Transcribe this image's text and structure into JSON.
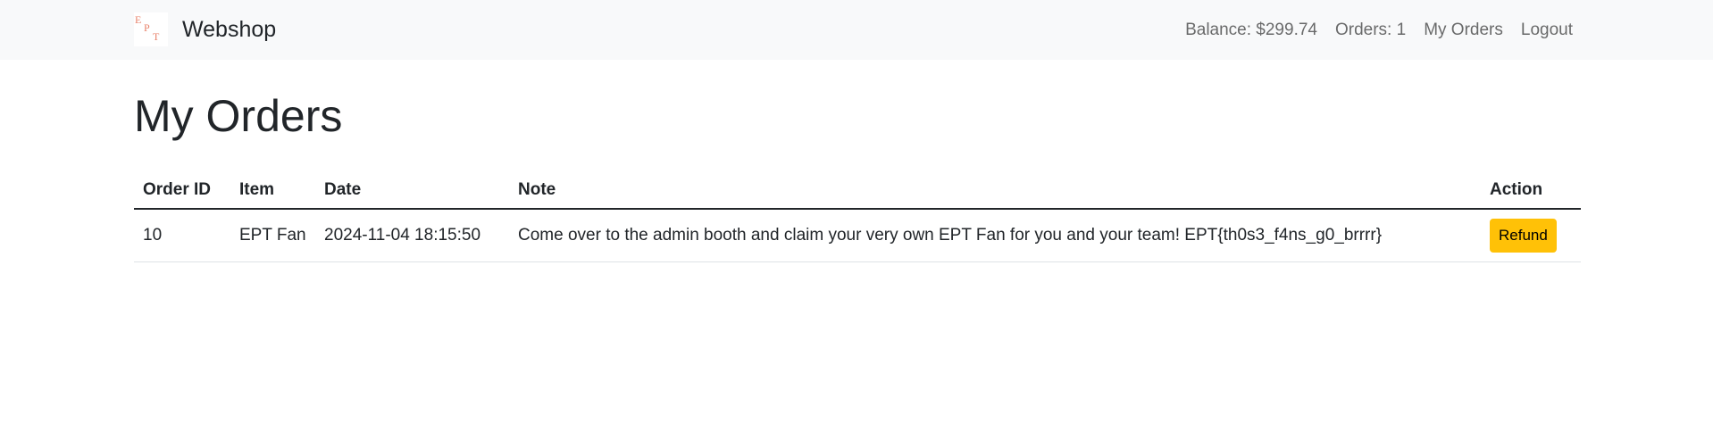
{
  "navbar": {
    "brand": "Webshop",
    "logo_text": "EPT",
    "balance": "Balance: $299.74",
    "orders_count": "Orders: 1",
    "my_orders_link": "My Orders",
    "logout_link": "Logout"
  },
  "page": {
    "title": "My Orders"
  },
  "table": {
    "headers": {
      "order_id": "Order ID",
      "item": "Item",
      "date": "Date",
      "note": "Note",
      "action": "Action"
    },
    "rows": [
      {
        "order_id": "10",
        "item": "EPT Fan",
        "date": "2024-11-04 18:15:50",
        "note": "Come over to the admin booth and claim your very own EPT Fan for you and your team! EPT{th0s3_f4ns_g0_brrrr}",
        "action_label": "Refund"
      }
    ]
  },
  "colors": {
    "navbar_bg": "#f8f9fa",
    "refund_button": "#ffc107",
    "logo_text": "#e8836b"
  }
}
